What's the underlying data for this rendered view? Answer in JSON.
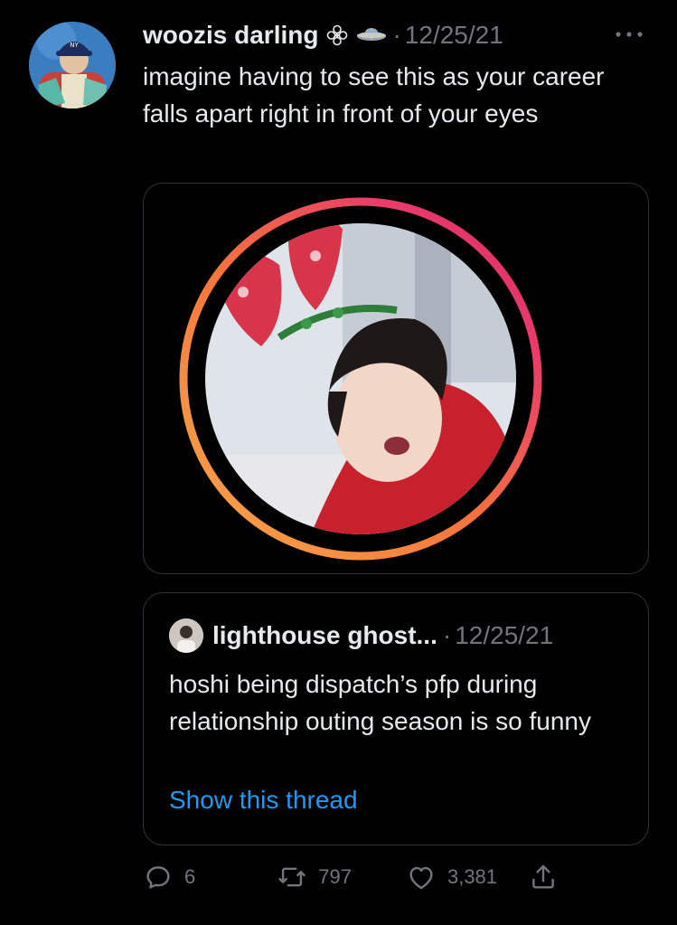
{
  "tweet": {
    "author_name": "woozis darling",
    "author_emojis": [
      "flower-icon",
      "ufo-icon"
    ],
    "separator": "·",
    "date": "12/25/21",
    "more_icon": "more-icon",
    "text": "imagine having to see this as your career falls apart right in front of your eyes"
  },
  "media": {
    "description_icon": "story-ring-photo"
  },
  "quoted_tweet": {
    "author_name": "lighthouse ghost...",
    "separator": "·",
    "date": "12/25/21",
    "text": "hoshi being dispatch’s pfp during relationship outing season is so funny",
    "link": "Show this thread"
  },
  "actions": {
    "replies": "6",
    "retweets": "797",
    "likes": "3,381"
  },
  "colors": {
    "background": "#000000",
    "text": "#e7e9ea",
    "muted": "#71767b",
    "link": "#1d9bf0",
    "border": "#2f3336"
  }
}
